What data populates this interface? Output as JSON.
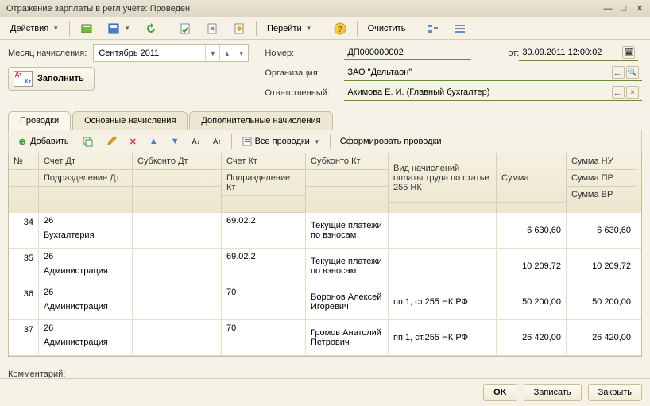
{
  "title": "Отражение зарплаты в регл учете: Проведен",
  "toolbar": {
    "actions": "Действия",
    "go": "Перейти",
    "clear": "Очистить"
  },
  "period": {
    "label": "Месяц начисления:",
    "value": "Сентябрь 2011"
  },
  "fill_btn": "Заполнить",
  "fields": {
    "number_label": "Номер:",
    "number_value": "ДП000000002",
    "from_label": "от:",
    "from_value": "30.09.2011 12:00:02",
    "org_label": "Организация:",
    "org_value": "ЗАО \"Дельтаон\"",
    "resp_label": "Ответственный:",
    "resp_value": "Акимова Е. И. (Главный бухгалтер)"
  },
  "tabs": {
    "t1": "Проводки",
    "t2": "Основные начисления",
    "t3": "Дополнительные начисления"
  },
  "subtb": {
    "add": "Добавить",
    "all": "Все проводки",
    "form": "Сформировать проводки"
  },
  "headers": {
    "num": "№",
    "dt": "Счет Дт",
    "dept_dt": "Подразделение Дт",
    "sub_dt": "Субконто Дт",
    "kt": "Счет Кт",
    "dept_kt": "Подразделение Кт",
    "sub_kt": "Субконто Кт",
    "vid": "Вид начислений оплаты труда по статье 255 НК",
    "sum": "Сумма",
    "sum_nu": "Сумма НУ",
    "sum_pr": "Сумма ПР",
    "sum_vr": "Сумма ВР"
  },
  "rows": [
    {
      "num": "34",
      "dt": "26",
      "dept_dt": "Бухгалтерия",
      "kt": "69.02.2",
      "sub_kt": "Текущие платежи по взносам",
      "vid": "",
      "sum": "6 630,60",
      "sum_nu": "6 630,60"
    },
    {
      "num": "35",
      "dt": "26",
      "dept_dt": "Администрация",
      "kt": "69.02.2",
      "sub_kt": "Текущие платежи по взносам",
      "vid": "",
      "sum": "10 209,72",
      "sum_nu": "10 209,72"
    },
    {
      "num": "36",
      "dt": "26",
      "dept_dt": "Администрация",
      "kt": "70",
      "sub_kt": "Воронов Алексей Игоревич",
      "vid": "пп.1, ст.255 НК РФ",
      "sum": "50 200,00",
      "sum_nu": "50 200,00"
    },
    {
      "num": "37",
      "dt": "26",
      "dept_dt": "Администрация",
      "kt": "70",
      "sub_kt": "Громов Анатолий Петрович",
      "vid": "пп.1, ст.255 НК РФ",
      "sum": "26 420,00",
      "sum_nu": "26 420,00"
    }
  ],
  "comment_label": "Комментарий:",
  "bottom": {
    "ok": "OK",
    "save": "Записать",
    "close": "Закрыть"
  }
}
